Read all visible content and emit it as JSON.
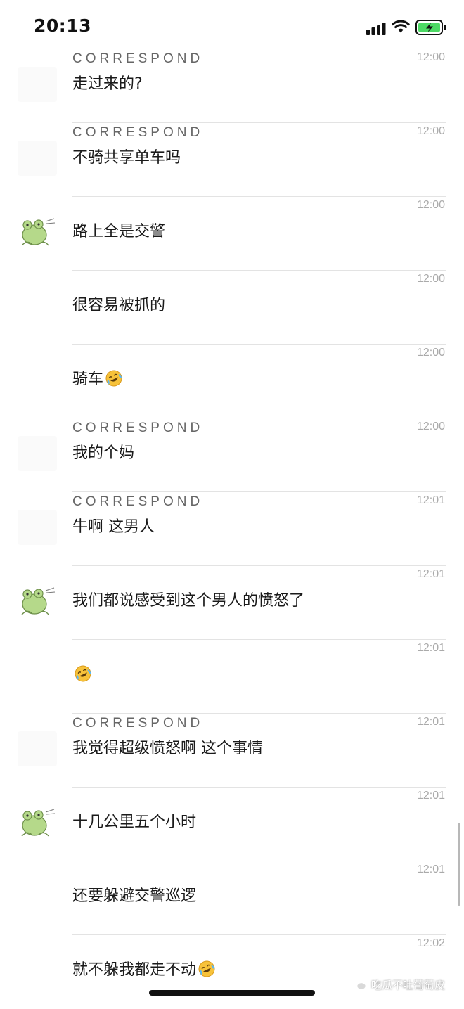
{
  "status_bar": {
    "time": "20:13",
    "signal_icon": "cellular-signal-icon",
    "wifi_icon": "wifi-icon",
    "battery_icon": "battery-charging-icon",
    "battery_color": "#4cd964"
  },
  "sender_label": "CORRESPOND",
  "messages": [
    {
      "sender": "CORRESPOND",
      "time": "12:00",
      "text": "走过来的?"
    },
    {
      "sender": "CORRESPOND",
      "time": "12:00",
      "text": "不骑共享单车吗"
    },
    {
      "sender": "",
      "time": "12:00",
      "text": "路上全是交警",
      "avatar": "frog-avatar-icon"
    },
    {
      "sender": "",
      "time": "12:00",
      "text": "很容易被抓的"
    },
    {
      "sender": "",
      "time": "12:00",
      "text": "骑车",
      "emoji": "laughing-crying-emoji-icon"
    },
    {
      "sender": "CORRESPOND",
      "time": "12:00",
      "text": "我的个妈"
    },
    {
      "sender": "CORRESPOND",
      "time": "12:01",
      "text": "牛啊 这男人"
    },
    {
      "sender": "",
      "time": "12:01",
      "text": "我们都说感受到这个男人的愤怒了",
      "avatar": "frog-avatar-icon"
    },
    {
      "sender": "",
      "time": "12:01",
      "text": "",
      "emoji": "laughing-crying-emoji-icon"
    },
    {
      "sender": "CORRESPOND",
      "time": "12:01",
      "text": "我觉得超级愤怒啊 这个事情"
    },
    {
      "sender": "",
      "time": "12:01",
      "text": "十几公里五个小时",
      "avatar": "frog-avatar-icon"
    },
    {
      "sender": "",
      "time": "12:01",
      "text": "还要躲避交警巡逻"
    },
    {
      "sender": "",
      "time": "12:02",
      "text": "就不躲我都走不动",
      "emoji": "laughing-crying-emoji-icon"
    }
  ],
  "watermark": {
    "text": "吃瓜不吐葡萄皮",
    "icon": "wechat-icon"
  }
}
